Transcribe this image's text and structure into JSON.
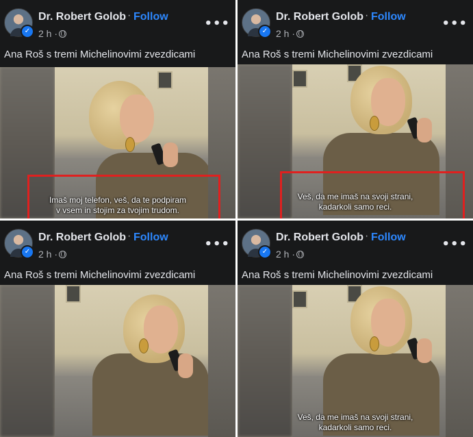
{
  "post": {
    "author": "Dr. Robert Golob",
    "separator": "·",
    "follow_label": "Follow",
    "time": "2 h ·",
    "caption": "Ana Roš s tremi Michelinovimi zvezdicami",
    "more": "•••",
    "verified_mark": "✓"
  },
  "subtitles": {
    "panel1": [
      "Imaš moj telefon, veš, da te podpiram",
      "v vsem in stojim za tvojim trudom."
    ],
    "panel2": [
      "Veš, da me imaš na svoji strani,",
      "kadarkoli samo reci."
    ],
    "panel4": [
      "Veš, da me imaš na svoji strani,",
      "kadarkoli samo reci."
    ]
  },
  "colors": {
    "highlight": "#e0201f",
    "follow": "#2d88ff",
    "background": "#18191a"
  }
}
